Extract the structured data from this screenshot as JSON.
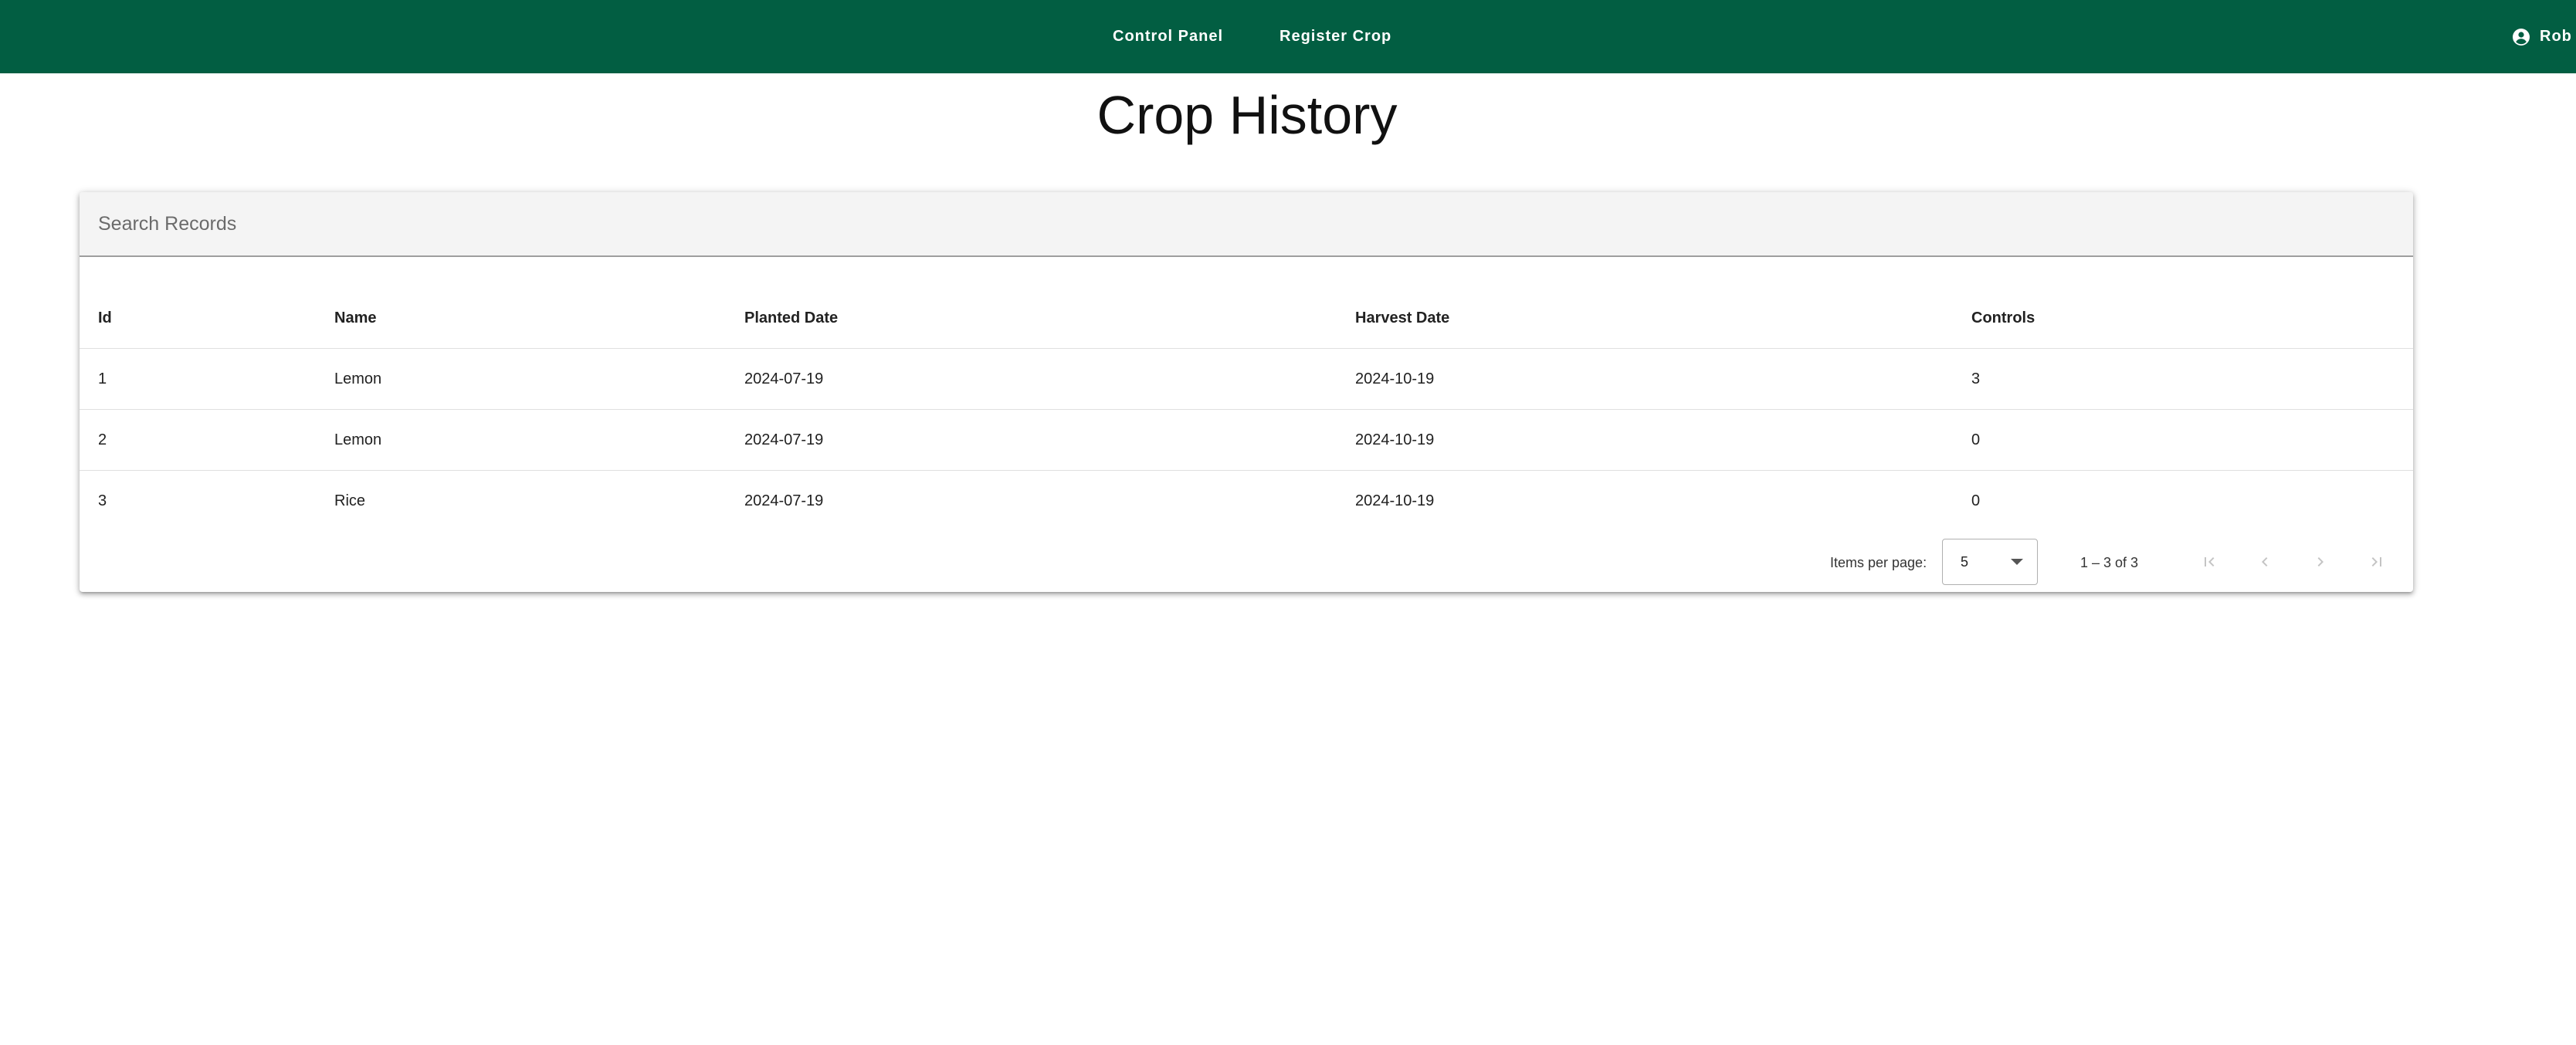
{
  "nav": {
    "links": [
      {
        "label": "Control Panel"
      },
      {
        "label": "Register Crop"
      }
    ],
    "user": {
      "label": "Rob",
      "icon": "account-circle-icon"
    }
  },
  "page": {
    "title": "Crop History"
  },
  "search": {
    "placeholder": "Search Records",
    "value": ""
  },
  "table": {
    "columns": [
      "Id",
      "Name",
      "Planted Date",
      "Harvest Date",
      "Controls"
    ],
    "rows": [
      [
        "1",
        "Lemon",
        "2024-07-19",
        "2024-10-19",
        "3"
      ],
      [
        "2",
        "Lemon",
        "2024-07-19",
        "2024-10-19",
        "0"
      ],
      [
        "3",
        "Rice",
        "2024-07-19",
        "2024-10-19",
        "0"
      ]
    ]
  },
  "paginator": {
    "items_per_page_label": "Items per page:",
    "items_per_page_value": "5",
    "range_label": "1 – 3 of 3",
    "buttons": [
      "first-page-icon",
      "previous-page-icon",
      "next-page-icon",
      "last-page-icon"
    ]
  },
  "colors": {
    "topbar": "#025e42",
    "nav_text": "#ffffff",
    "disabled_icon": "#c4c4c4"
  }
}
